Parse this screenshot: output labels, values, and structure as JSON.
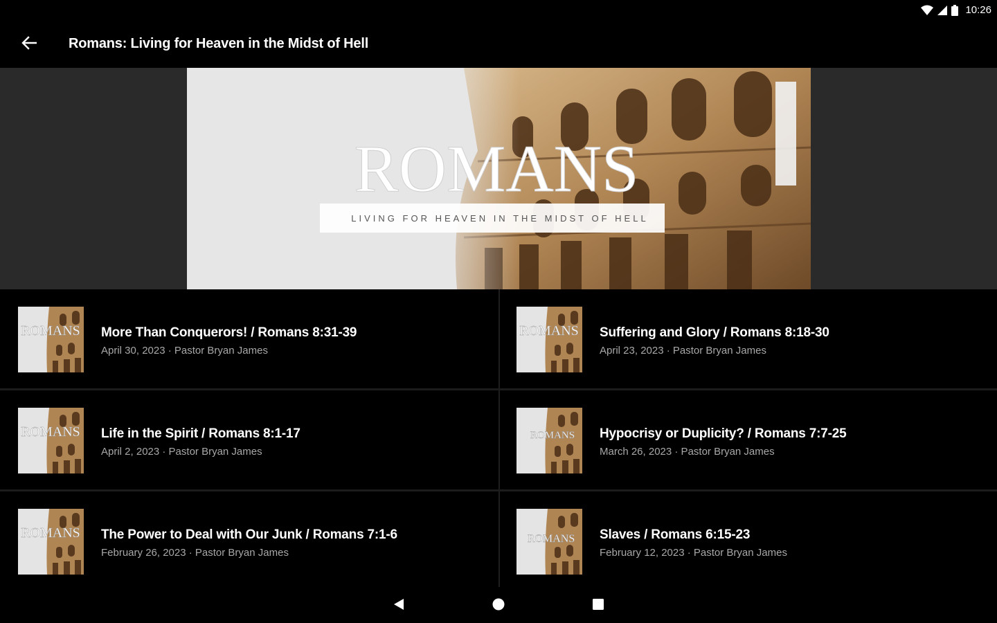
{
  "status": {
    "time": "10:26"
  },
  "app_bar": {
    "title": "Romans: Living for Heaven in the Midst of Hell"
  },
  "banner": {
    "title": "ROMANS",
    "subtitle": "LIVING FOR HEAVEN IN THE MIDST OF HELL"
  },
  "thumb": {
    "title": "ROMANS"
  },
  "sermons": [
    {
      "title": "More Than Conquerors! / Romans 8:31-39",
      "subtitle": "April 30, 2023 · Pastor Bryan James"
    },
    {
      "title": "Suffering and Glory / Romans 8:18-30",
      "subtitle": "April 23, 2023 · Pastor Bryan James"
    },
    {
      "title": "Life in the Spirit / Romans 8:1-17",
      "subtitle": "April 2, 2023 · Pastor Bryan James"
    },
    {
      "title": "Hypocrisy or Duplicity? / Romans 7:7-25",
      "subtitle": "March 26, 2023 · Pastor Bryan James"
    },
    {
      "title": "The Power to Deal with Our Junk / Romans 7:1-6",
      "subtitle": "February 26, 2023 · Pastor Bryan James"
    },
    {
      "title": "Slaves / Romans 6:15-23",
      "subtitle": "February 12, 2023 · Pastor Bryan James"
    }
  ],
  "icons": {
    "back": "arrow-left-icon",
    "wifi": "wifi-icon",
    "signal": "signal-icon",
    "battery": "battery-icon",
    "nav_back": "triangle-back-icon",
    "nav_home": "circle-home-icon",
    "nav_recents": "square-recents-icon"
  },
  "colors": {
    "background": "#000000",
    "banner_backdrop": "#2a2a2a",
    "subtitle": "#a8a8a8",
    "stone": "#b0895a"
  }
}
